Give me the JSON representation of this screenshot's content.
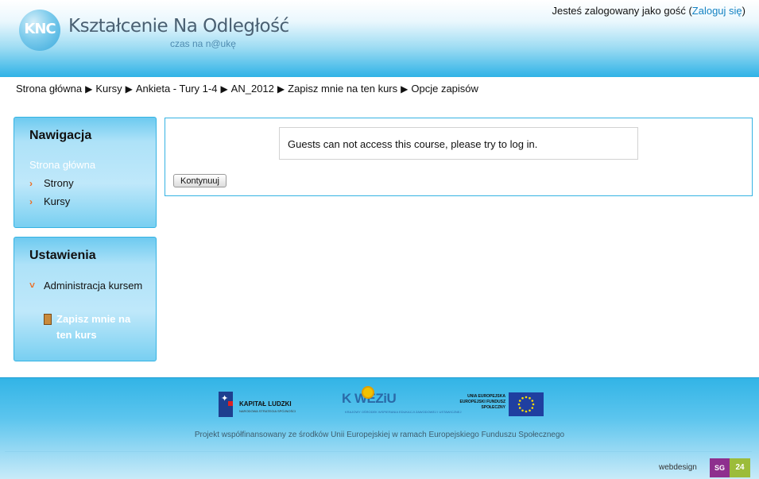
{
  "header": {
    "logo_mark": "KNC",
    "logo_title": "Kształcenie Na Odległość",
    "logo_subtitle": "czas na n@ukę",
    "login_prefix": "Jesteś zalogowany jako gość (",
    "login_link": "Zaloguj się",
    "login_suffix": ")"
  },
  "breadcrumb": {
    "separator": "▶",
    "items": [
      "Strona główna",
      "Kursy",
      "Ankieta - Tury 1-4",
      "AN_2012",
      "Zapisz mnie na ten kurs",
      "Opcje zapisów"
    ]
  },
  "navigation": {
    "title": "Nawigacja",
    "home": "Strona główna",
    "items": [
      "Strony",
      "Kursy"
    ]
  },
  "settings": {
    "title": "Ustawienia",
    "admin_label": "Administracja kursem",
    "enrol_label": "Zapisz mnie na ten kurs"
  },
  "main": {
    "notice": "Guests can not access this course, please try to log in.",
    "continue_button": "Kontynuuj"
  },
  "footer": {
    "kl_title": "KAPITAŁ LUDZKI",
    "kl_subtitle": "NARODOWA STRATEGIA SPÓJNOŚCI",
    "kw_title": "K WEZiU",
    "kw_subtitle": "KRAJOWY OŚRODEK WSPIERANIA EDUKACJI ZAWODOWEJ I USTAWICZNEJ",
    "ue_text": "UNIA EUROPEJSKA EUROPEJSKI FUNDUSZ SPOŁECZNY",
    "cofinance_text": "Projekt współfinansowany ze środków Unii Europejskiej w ramach Europejskiego Funduszu Społecznego",
    "webdesign_label": "webdesign",
    "sg_label": "SG",
    "n24_label": "24"
  },
  "colors": {
    "accent": "#35b3e3",
    "link": "#1583c3",
    "chevron": "#ee6b1f"
  }
}
